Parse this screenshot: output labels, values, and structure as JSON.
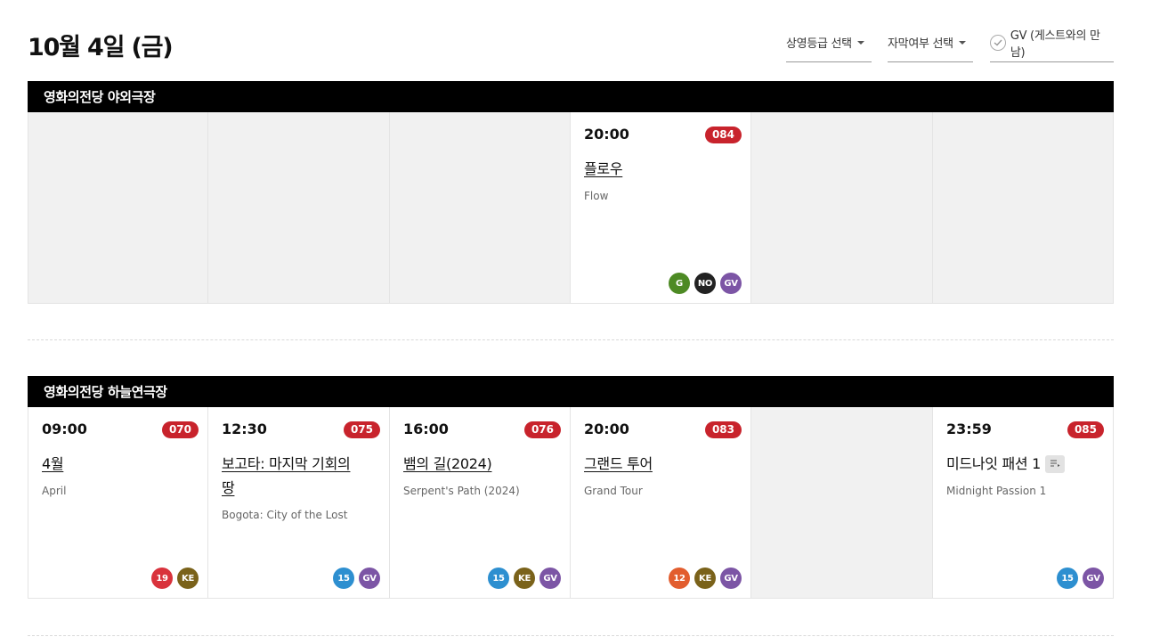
{
  "page": {
    "title": "10월 4일 (금)"
  },
  "filters": {
    "rating": {
      "label": "상영등급 선택"
    },
    "subtitle": {
      "label": "자막여부 선택"
    },
    "gv": {
      "label": "GV (게스트와의 만남)"
    }
  },
  "badge_colors": {
    "G": "#4d8a24",
    "NO": "#222222",
    "GV": "#7c55a5",
    "19": "#d9323c",
    "KE": "#7a621a",
    "15": "#2d8fd0",
    "12": "#e25d2e"
  },
  "venues": [
    {
      "name": "영화의전당 야외극장",
      "slots": [
        {
          "empty": true
        },
        {
          "empty": true
        },
        {
          "empty": true
        },
        {
          "empty": false,
          "time": "20:00",
          "code": "084",
          "title_ko": "플로우",
          "title_en": "Flow",
          "badges": [
            "G",
            "NO",
            "GV"
          ]
        },
        {
          "empty": true
        },
        {
          "empty": true
        }
      ]
    },
    {
      "name": "영화의전당 하늘연극장",
      "slots": [
        {
          "empty": false,
          "time": "09:00",
          "code": "070",
          "title_ko": "4월",
          "title_en": "April",
          "badges": [
            "19",
            "KE"
          ]
        },
        {
          "empty": false,
          "time": "12:30",
          "code": "075",
          "title_ko": "보고타: 마지막 기회의 땅",
          "title_en": "Bogota: City of the Lost",
          "badges": [
            "15",
            "GV"
          ]
        },
        {
          "empty": false,
          "time": "16:00",
          "code": "076",
          "title_ko": "뱀의 길(2024)",
          "title_en": "Serpent's Path (2024)",
          "badges": [
            "15",
            "KE",
            "GV"
          ]
        },
        {
          "empty": false,
          "time": "20:00",
          "code": "083",
          "title_ko": "그랜드 투어",
          "title_en": "Grand Tour",
          "badges": [
            "12",
            "KE",
            "GV"
          ]
        },
        {
          "empty": true
        },
        {
          "empty": false,
          "time": "23:59",
          "code": "085",
          "title_ko": "미드나잇 패션 1",
          "title_en": "Midnight Passion 1",
          "badges": [
            "15",
            "GV"
          ],
          "plain_title": true,
          "note_icon": true
        }
      ]
    }
  ]
}
